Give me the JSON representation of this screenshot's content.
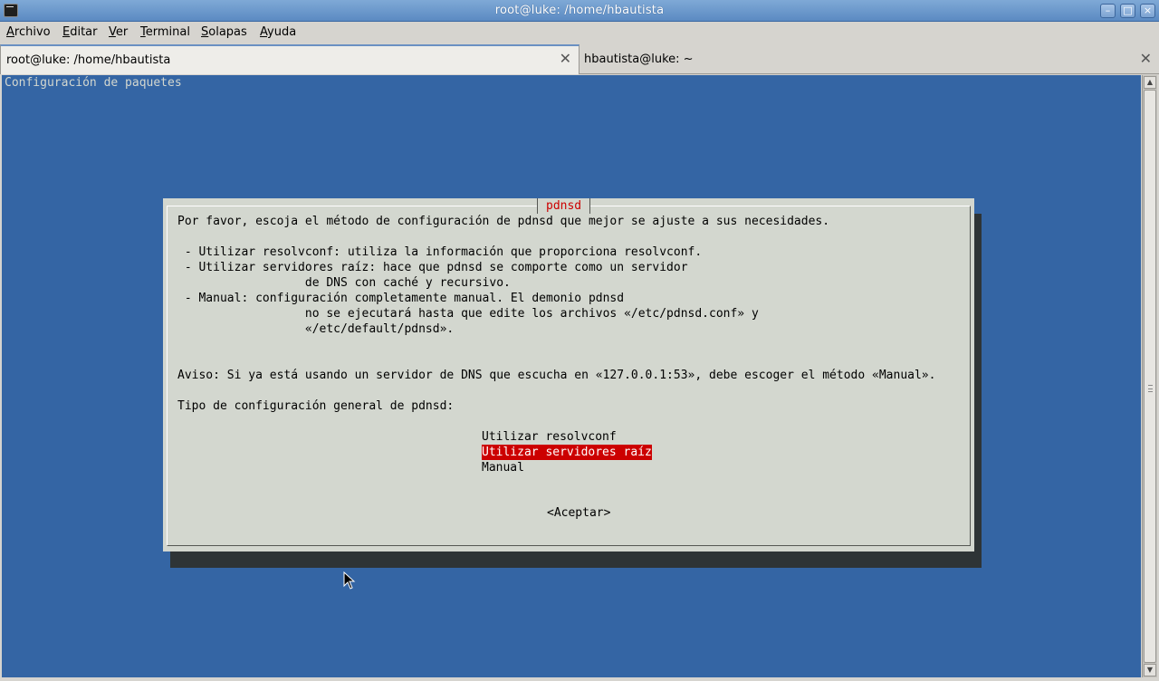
{
  "window": {
    "title": "root@luke: /home/hbautista",
    "minimize_glyph": "–",
    "maximize_glyph": "□",
    "close_glyph": "×"
  },
  "menu": {
    "items": [
      "Archivo",
      "Editar",
      "Ver",
      "Terminal",
      "Solapas",
      "Ayuda"
    ]
  },
  "tabs": [
    {
      "label": "root@luke: /home/hbautista",
      "active": true
    },
    {
      "label": "hbautista@luke: ~",
      "active": false
    }
  ],
  "terminal": {
    "header": "Configuración de paquetes",
    "background_color": "#3465a4"
  },
  "dialog": {
    "title": "pdnsd",
    "lines": [
      "Por favor, escoja el método de configuración de pdnsd que mejor se ajuste a sus necesidades.",
      "",
      " - Utilizar resolvconf: utiliza la información que proporciona resolvconf.",
      " - Utilizar servidores raíz: hace que pdnsd se comporte como un servidor",
      "                  de DNS con caché y recursivo.",
      " - Manual: configuración completamente manual. El demonio pdnsd",
      "                  no se ejecutará hasta que edite los archivos «/etc/pdnsd.conf» y",
      "                  «/etc/default/pdnsd».",
      "",
      "",
      "Aviso: Si ya está usando un servidor de DNS que escucha en «127.0.0.1:53», debe escoger el método «Manual».",
      "",
      "Tipo de configuración general de pdnsd:"
    ],
    "options": [
      "Utilizar resolvconf",
      "Utilizar servidores raíz",
      "Manual"
    ],
    "selected_option": "Utilizar servidores raíz",
    "ok_label": "<Aceptar>",
    "selection_color": "#cc0000"
  },
  "icons": {
    "app": "terminal-icon",
    "tab_close": "close-icon",
    "cursor": "mouse-pointer-icon"
  }
}
